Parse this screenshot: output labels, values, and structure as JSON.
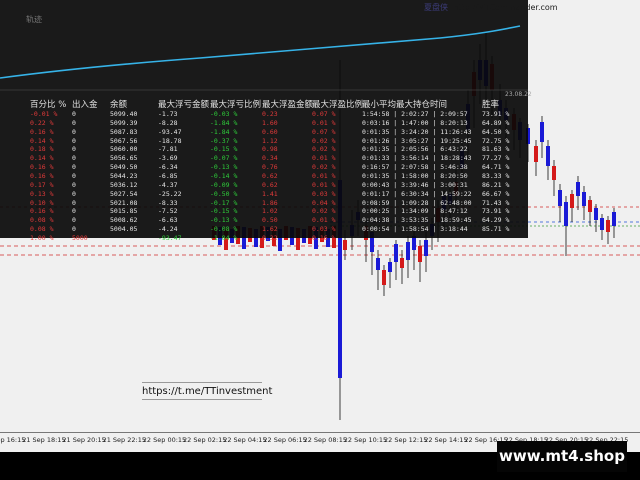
{
  "brand": {
    "name": "夏盘侠",
    "url": "http://MTCommander.com"
  },
  "panel": {
    "title": "轨迹",
    "timestamp": "23.08.22"
  },
  "table": {
    "headers": [
      "百分比 %",
      "出入金",
      "余额",
      "最大浮亏金额",
      "最大浮亏比例",
      "最大浮盈金额",
      "最大浮盈比例",
      "最小平均最大持仓时间",
      "胜率"
    ],
    "rows": [
      [
        "-0.01 %",
        "0",
        "5099.40",
        "-1.73",
        "-0.03 %",
        "0.23",
        "0.07 %",
        "1:54:58 | 2:02:27 | 2:09:57",
        "73.91 %"
      ],
      [
        "0.22 %",
        "0",
        "5099.39",
        "-8.28",
        "-1.84 %",
        "1.60",
        "0.01 %",
        "0:03:16 | 1:47:00 | 8:20:13",
        "64.89 %"
      ],
      [
        "0.16 %",
        "0",
        "5087.83",
        "-93.47",
        "-1.84 %",
        "0.60",
        "0.07 %",
        "0:01:35 | 3:24:20 | 11:26:43",
        "64.50 %"
      ],
      [
        "0.14 %",
        "0",
        "5067.56",
        "-18.78",
        "-0.37 %",
        "1.12",
        "0.02 %",
        "0:01:26 | 3:05:27 | 19:25:45",
        "72.75 %"
      ],
      [
        "0.18 %",
        "0",
        "5060.00",
        "-7.81",
        "-0.15 %",
        "0.98",
        "0.02 %",
        "0:01:35 | 2:05:56 | 6:43:22",
        "81.63 %"
      ],
      [
        "0.14 %",
        "0",
        "5056.65",
        "-3.69",
        "-0.07 %",
        "0.34",
        "0.01 %",
        "0:01:33 | 3:56:14 | 18:28:43",
        "77.27 %"
      ],
      [
        "0.16 %",
        "0",
        "5049.50",
        "-6.34",
        "-0.13 %",
        "0.76",
        "0.02 %",
        "0:16:57 | 2:07:58 | 5:46:38",
        "64.71 %"
      ],
      [
        "0.16 %",
        "0",
        "5044.23",
        "-6.85",
        "-0.14 %",
        "0.62",
        "0.01 %",
        "0:01:35 | 1:58:00 | 8:20:50",
        "83.33 %"
      ],
      [
        "0.17 %",
        "0",
        "5036.12",
        "-4.37",
        "-0.09 %",
        "0.62",
        "0.01 %",
        "0:00:43 | 3:39:46 | 3:00:31",
        "86.21 %"
      ],
      [
        "0.13 %",
        "0",
        "5027.54",
        "-25.22",
        "-0.50 %",
        "1.41",
        "0.03 %",
        "0:01:17 | 6:30:34 | 14:59:22",
        "66.67 %"
      ],
      [
        "0.10 %",
        "0",
        "5021.08",
        "-8.33",
        "-0.17 %",
        "1.86",
        "0.04 %",
        "0:08:59 | 1:09:28 | 62:48:00",
        "71.43 %"
      ],
      [
        "0.16 %",
        "0",
        "5015.85",
        "-7.52",
        "-0.15 %",
        "1.02",
        "0.02 %",
        "0:00:25 | 1:34:09 | 8:47:12",
        "73.91 %"
      ],
      [
        "0.08 %",
        "0",
        "5008.62",
        "-6.63",
        "-0.13 %",
        "0.50",
        "0.01 %",
        "0:04:38 | 3:53:35 | 18:59:45",
        "64.29 %"
      ],
      [
        "0.08 %",
        "0",
        "5004.05",
        "-4.24",
        "-0.08 %",
        "1.62",
        "0.03 %",
        "0:00:54 | 1:58:54 | 3:18:44",
        "85.71 %"
      ],
      [
        "1.00 %",
        "5000",
        "",
        "-93.47",
        "-1.84 %",
        "0.32",
        "0.16 %",
        "",
        ""
      ]
    ],
    "colors": [
      "#e03a3a",
      "#e6e6e6",
      "#e6e6e6",
      "#e6e6e6",
      "#2ecc3a",
      "#e03a3a",
      "#e03a3a",
      "#e6e6e6",
      "#e6e6e6"
    ],
    "total_colors": [
      "#e03a3a",
      "#e03a3a",
      "#e6e6e6",
      "#2ecc3a",
      "#2ecc3a",
      "#e03a3a",
      "#e03a3a",
      "#e6e6e6",
      "#e6e6e6"
    ]
  },
  "telegram": "https://t.me/TTinvestment",
  "watermark": "www.mt4.shop",
  "x_axis_labels": [
    "21 Sep 16:15",
    "21 Sep 18:15",
    "21 Sep 20:15",
    "21 Sep 22:15",
    "22 Sep 00:15",
    "22 Sep 02:15",
    "22 Sep 04:15",
    "22 Sep 06:15",
    "22 Sep 08:15",
    "22 Sep 10:15",
    "22 Sep 12:15",
    "22 Sep 14:15",
    "22 Sep 16:15",
    "22 Sep 18:15",
    "22 Sep 20:15",
    "22 Sep 22:15"
  ],
  "colors": {
    "bull": "#1a1ad6",
    "bear": "#d41a1a",
    "balance_line": "#36b3e8",
    "level_red": "#d02a2a",
    "level_blue": "#1f4fd4",
    "level_green": "#3a9a3a"
  }
}
